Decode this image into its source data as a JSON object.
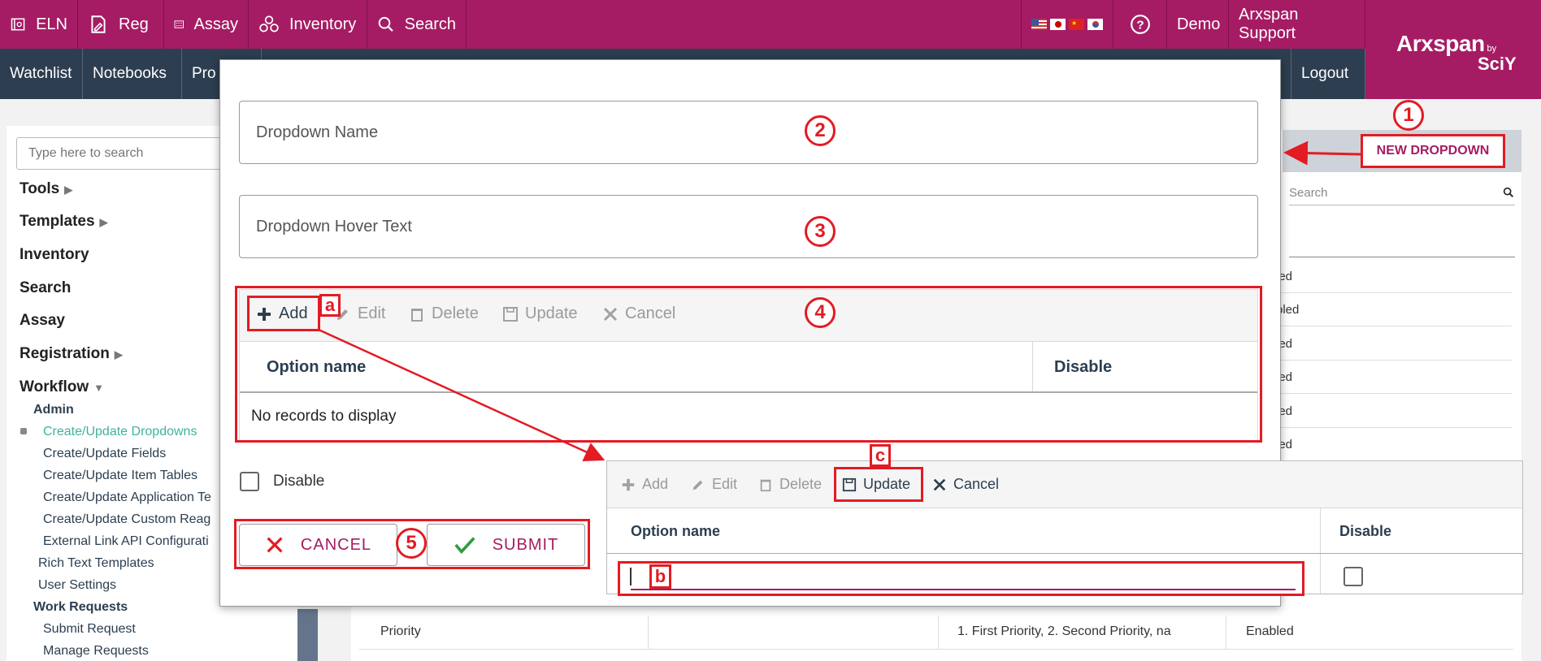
{
  "topnav": {
    "eln": "ELN",
    "reg": "Reg",
    "assay": "Assay",
    "inventory": "Inventory",
    "search": "Search",
    "demo": "Demo",
    "support": "Arxspan Support"
  },
  "subnav": {
    "watchlist": "Watchlist",
    "notebooks": "Notebooks",
    "projects_partial": "Pro",
    "logout": "Logout"
  },
  "logo": {
    "main": "Arxspan",
    "by": "by",
    "sciy": "SciY"
  },
  "sidebar": {
    "search_placeholder": "Type here to search",
    "tools": "Tools",
    "templates": "Templates",
    "inventory": "Inventory",
    "search": "Search",
    "assay": "Assay",
    "registration": "Registration",
    "workflow": "Workflow",
    "admin": "Admin",
    "admin_items": [
      "Create/Update Dropdowns",
      "Create/Update Fields",
      "Create/Update Item Tables",
      "Create/Update Application Te",
      "Create/Update Custom Reag",
      "External Link API Configurati"
    ],
    "rich_text": "Rich Text Templates",
    "user_settings": "User Settings",
    "work_requests": "Work Requests",
    "submit_request": "Submit Request",
    "manage_requests": "Manage Requests"
  },
  "background": {
    "new_dropdown": "NEW DROPDOWN",
    "search_placeholder": "Search",
    "status_partials": [
      "led",
      "bled",
      "led",
      "led",
      "led",
      "led"
    ],
    "priority_row": {
      "name": "Priority",
      "options": "1. First Priority, 2. Second Priority, na",
      "status": "Enabled"
    }
  },
  "modal": {
    "dropdown_name": "Dropdown Name",
    "hover_text": "Dropdown Hover Text",
    "toolbar": {
      "add": "Add",
      "edit": "Edit",
      "delete": "Delete",
      "update": "Update",
      "cancel": "Cancel"
    },
    "col_option": "Option name",
    "col_disable": "Disable",
    "empty": "No records to display",
    "disable_label": "Disable",
    "cancel_btn": "CANCEL",
    "submit_btn": "SUBMIT"
  },
  "zoom": {
    "toolbar": {
      "add": "Add",
      "edit": "Edit",
      "delete": "Delete",
      "update": "Update",
      "cancel": "Cancel"
    },
    "col_option": "Option name",
    "col_disable": "Disable"
  },
  "annotations": {
    "n1": "1",
    "n2": "2",
    "n3": "3",
    "n4": "4",
    "n5": "5",
    "a": "a",
    "b": "b",
    "c": "c"
  },
  "colors": {
    "brand": "#a51c64",
    "nav_dark": "#2c3e50",
    "annotation": "#e31b23"
  }
}
